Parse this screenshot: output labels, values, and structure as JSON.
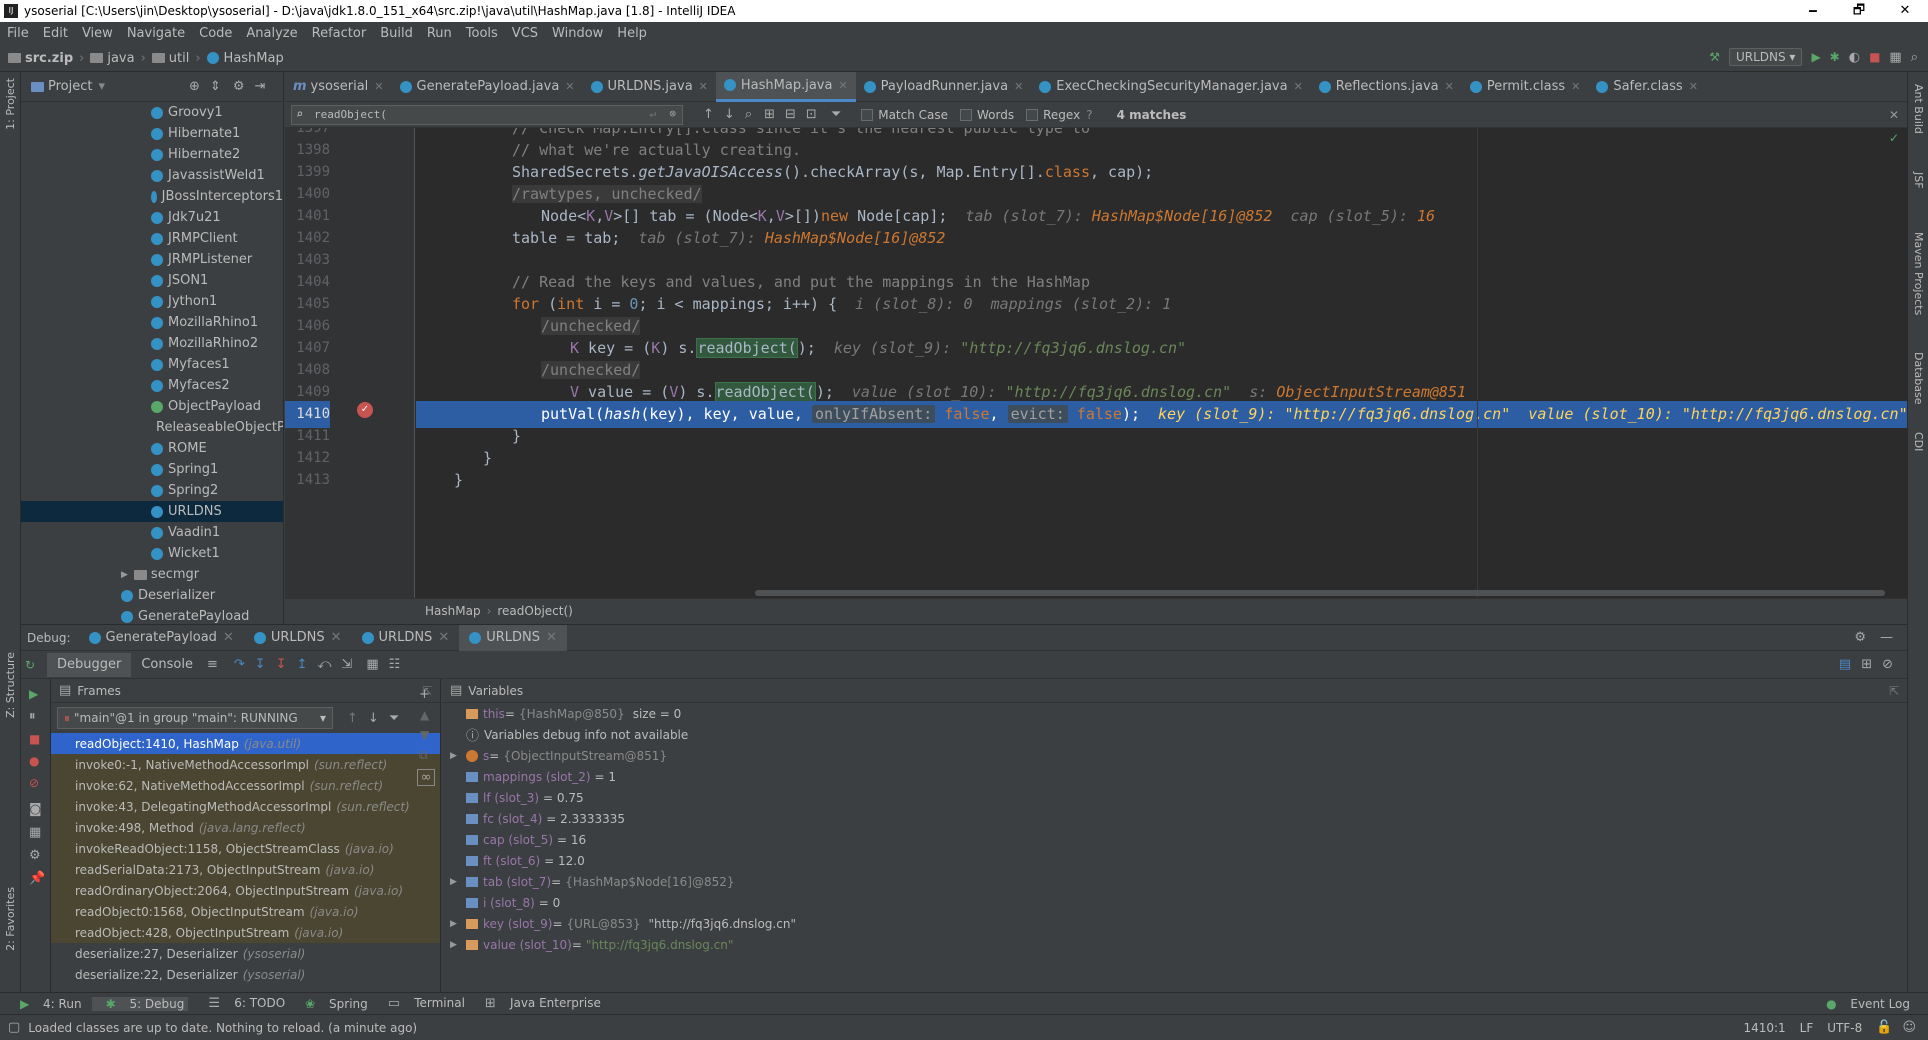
{
  "window": {
    "title": "ysoserial [C:\\Users\\jin\\Desktop\\ysoserial] - D:\\java\\jdk1.8.0_151_x64\\src.zip!\\java\\util\\HashMap.java [1.8] - IntelliJ IDEA",
    "minimize": "🗕",
    "maximize": "🗗",
    "close": "✕"
  },
  "menu": [
    "File",
    "Edit",
    "View",
    "Navigate",
    "Code",
    "Analyze",
    "Refactor",
    "Build",
    "Run",
    "Tools",
    "VCS",
    "Window",
    "Help"
  ],
  "nav": {
    "crumbs": [
      "src.zip",
      "java",
      "util",
      "HashMap"
    ],
    "run_config": "URLDNS"
  },
  "project": {
    "header": "Project",
    "items": [
      "Groovy1",
      "Hibernate1",
      "Hibernate2",
      "JavassistWeld1",
      "JBossInterceptors1",
      "Jdk7u21",
      "JRMPClient",
      "JRMPListener",
      "JSON1",
      "Jython1",
      "MozillaRhino1",
      "MozillaRhino2",
      "Myfaces1",
      "Myfaces2",
      "ObjectPayload",
      "ReleaseableObjectPayload",
      "ROME",
      "Spring1",
      "Spring2",
      "URLDNS",
      "Vaadin1",
      "Wicket1",
      "secmgr",
      "Deserializer",
      "GeneratePayload"
    ],
    "selected": "URLDNS"
  },
  "editor_tabs": [
    {
      "label": "ysoserial",
      "prefix": "m"
    },
    {
      "label": "GeneratePayload.java"
    },
    {
      "label": "URLDNS.java"
    },
    {
      "label": "HashMap.java",
      "active": true
    },
    {
      "label": "PayloadRunner.java"
    },
    {
      "label": "ExecCheckingSecurityManager.java"
    },
    {
      "label": "Reflections.java"
    },
    {
      "label": "Permit.class"
    },
    {
      "label": "Safer.class"
    }
  ],
  "find": {
    "query": "readObject(",
    "match_case": "Match Case",
    "words": "Words",
    "regex": "Regex",
    "help": "?",
    "matches": "4 matches"
  },
  "code": {
    "line_numbers": [
      "1397",
      "1398",
      "1399",
      "1400",
      "1401",
      "1402",
      "1403",
      "1404",
      "1405",
      "1406",
      "1407",
      "1408",
      "1409",
      "1410",
      "1411",
      "1412",
      "1413"
    ],
    "l1397": "// Check Map.Entry[].class since it's the nearest public type to",
    "l1398": "// what we're actually creating.",
    "l1399a": "SharedSecrets.",
    "l1399b": "getJavaOISAccess",
    "l1399c": "().checkArray(s, Map.Entry[].",
    "l1399d": "class",
    ", ": "",
    "l1399e": ", cap);",
    "l1400": "/rawtypes, unchecked/",
    "l1401a": "Node<",
    "l1401b": "K",
    "l1401c": ",",
    "l1401d": "V",
    "l1401e": ">[] tab = (Node<",
    "l1401f": "K",
    "l1401g": ",",
    "l1401h": "V",
    "l1401i": ">[])",
    "l1401j": "new",
    "l1401k": " Node[cap];",
    "l1401h1": "tab (slot_7): ",
    "l1401h2": "HashMap$Node[16]@852",
    "l1401h3": "  cap (slot_5): ",
    "l1401h4": "16",
    "l1402a": "table = tab;",
    "l1402h1": "tab (slot_7): ",
    "l1402h2": "HashMap$Node[16]@852",
    "l1404": "// Read the keys and values, and put the mappings in the HashMap",
    "l1405a": "for",
    "l1405b": " (",
    "l1405c": "int",
    "l1405d": " i = ",
    "l1405e": "0",
    "l1405f": "; i < mappings; i++) {",
    "l1405h1": "i (slot_8): ",
    "l1405h2": "0",
    "l1405h3": "  mappings (slot_2): ",
    "l1405h4": "1",
    "l1406": "/unchecked/",
    "l1407a": "K",
    "l1407b": " key = (",
    "l1407c": "K",
    "l1407d": ") s.",
    "l1407e": "readObject(",
    "l1407f": ");",
    "l1407h1": "key (slot_9): ",
    "l1407h2": "\"http://fq3jq6.dnslog.cn\"",
    "l1408": "/unchecked/",
    "l1409a": "V",
    "l1409b": " value = (",
    "l1409c": "V",
    "l1409d": ") s.",
    "l1409e": "readObject(",
    "l1409f": ");",
    "l1409h1": "value (slot_10): ",
    "l1409h2": "\"http://fq3jq6.dnslog.cn\"",
    "l1409h3": "  s: ",
    "l1409h4": "ObjectInputStream@851",
    "l1410a": "putVal(",
    "l1410b": "hash",
    "l1410c": "(key), key, value, ",
    "l1410d": "onlyIfAbsent:",
    "l1410e": " false",
    "l1410f": "evict:",
    "l1410g": " false",
    "l1410i": ");",
    "l1410h1": "key (slot_9): ",
    "l1410h2": "\"http://fq3jq6.dnslog.cn\"",
    "l1410h3": "  value (slot_10): ",
    "l1410h4": "\"http://fq3jq6.dnslog.cn\"",
    "brace": "}"
  },
  "editor_breadcrumb": [
    "HashMap",
    "readObject()"
  ],
  "debug": {
    "label": "Debug:",
    "tabs": [
      "GeneratePayload",
      "URLDNS",
      "URLDNS",
      "URLDNS"
    ],
    "debugger": "Debugger",
    "console": "Console",
    "frames_header": "Frames",
    "variables_header": "Variables",
    "thread": "\"main\"@1 in group \"main\": RUNNING",
    "frames": [
      {
        "m": "readObject:1410, HashMap",
        "p": "(java.util)"
      },
      {
        "m": "invoke0:-1, NativeMethodAccessorImpl",
        "p": "(sun.reflect)"
      },
      {
        "m": "invoke:62, NativeMethodAccessorImpl",
        "p": "(sun.reflect)"
      },
      {
        "m": "invoke:43, DelegatingMethodAccessorImpl",
        "p": "(sun.reflect)"
      },
      {
        "m": "invoke:498, Method",
        "p": "(java.lang.reflect)"
      },
      {
        "m": "invokeReadObject:1158, ObjectStreamClass",
        "p": "(java.io)"
      },
      {
        "m": "readSerialData:2173, ObjectInputStream",
        "p": "(java.io)"
      },
      {
        "m": "readOrdinaryObject:2064, ObjectInputStream",
        "p": "(java.io)"
      },
      {
        "m": "readObject0:1568, ObjectInputStream",
        "p": "(java.io)"
      },
      {
        "m": "readObject:428, ObjectInputStream",
        "p": "(java.io)"
      },
      {
        "m": "deserialize:27, Deserializer",
        "p": "(ysoserial)"
      },
      {
        "m": "deserialize:22, Deserializer",
        "p": "(ysoserial)"
      }
    ],
    "vars": [
      {
        "n": "this",
        "r": "{HashMap@850}",
        "v": "size = 0"
      },
      {
        "n": "",
        "r": "",
        "v": "Variables debug info not available"
      },
      {
        "n": "s",
        "r": "{ObjectInputStream@851}",
        "v": ""
      },
      {
        "n": "mappings (slot_2)",
        "r": "",
        "v": "= 1"
      },
      {
        "n": "lf (slot_3)",
        "r": "",
        "v": "= 0.75"
      },
      {
        "n": "fc (slot_4)",
        "r": "",
        "v": "= 2.3333335"
      },
      {
        "n": "cap (slot_5)",
        "r": "",
        "v": "= 16"
      },
      {
        "n": "ft (slot_6)",
        "r": "",
        "v": "= 12.0"
      },
      {
        "n": "tab (slot_7)",
        "r": "{HashMap$Node[16]@852}",
        "v": ""
      },
      {
        "n": "i (slot_8)",
        "r": "",
        "v": "= 0"
      },
      {
        "n": "key (slot_9)",
        "r": "{URL@853}",
        "v": "\"http://fq3jq6.dnslog.cn\""
      },
      {
        "n": "value (slot_10)",
        "r": "",
        "v": "\"http://fq3jq6.dnslog.cn\""
      }
    ]
  },
  "bottom_tabs": [
    "4: Run",
    "5: Debug",
    "6: TODO",
    "Spring",
    "Terminal",
    "Java Enterprise"
  ],
  "event_log": "Event Log",
  "status": {
    "message": "Loaded classes are up to date. Nothing to reload. (a minute ago)",
    "position": "1410:1",
    "line_sep": "LF",
    "encoding": "UTF-8"
  },
  "side_labels": {
    "left": [
      "1: Project",
      "Z: Structure",
      "2: Favorites"
    ],
    "right": [
      "Ant Build",
      "JSF",
      "Maven Projects",
      "Database",
      "CDI"
    ]
  },
  "colors": {
    "exec_line": "#2d5ea4",
    "selected_frame": "#2f65ca",
    "editor_bg": "#2b2b2b",
    "panel_bg": "#3c3f41"
  }
}
